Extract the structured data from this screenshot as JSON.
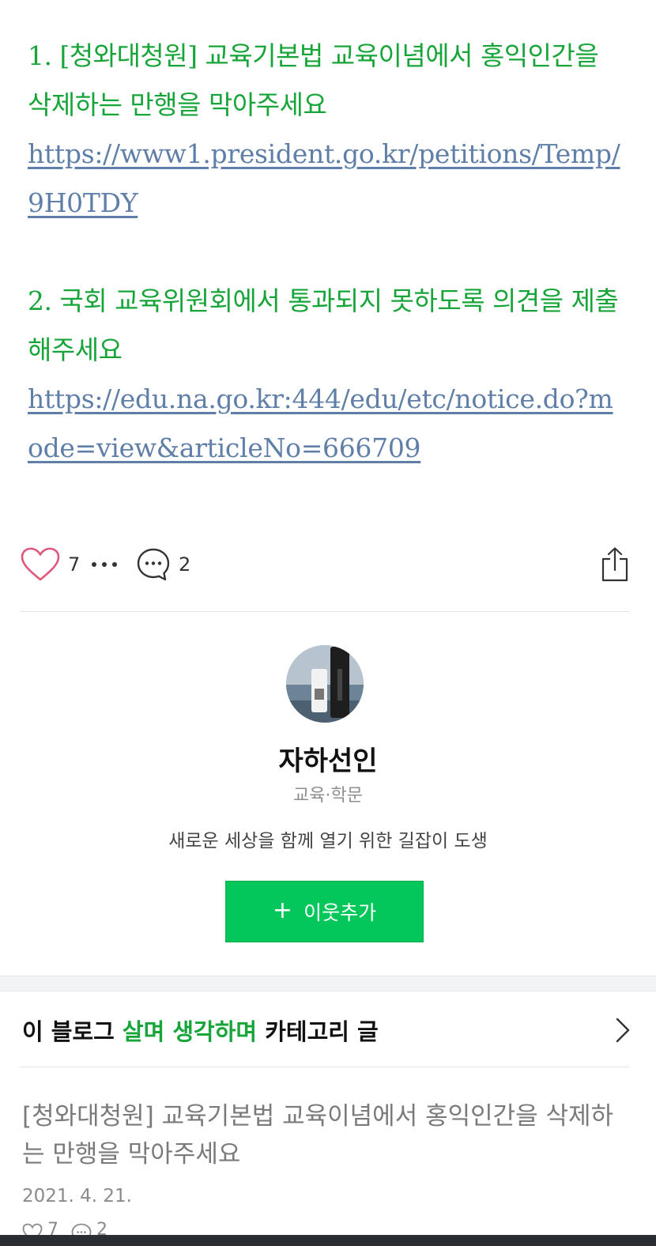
{
  "post": {
    "item1_title": "1. [청와대청원] 교육기본법 교육이념에서 홍익인간을 삭제하는 만행을 막아주세요",
    "item1_link": "https://www1.president.go.kr/petitions/Temp/9H0TDY",
    "item2_title": "2. 국회 교육위원회에서 통과되지 못하도록 의견을 제출해주세요",
    "item2_link": "https://edu.na.go.kr:444/edu/etc/notice.do?mode=view&articleNo=666709"
  },
  "actions": {
    "like_count": "7",
    "comment_count": "2",
    "heart_icon": "heart-icon",
    "more_icon": "more-dots-icon",
    "comment_icon": "comment-bubble-icon",
    "share_icon": "share-icon"
  },
  "profile": {
    "name": "자하선인",
    "category": "교육·학문",
    "description": "새로운 세상을 함께 열기 위한 길잡이 도생",
    "add_neighbor_label": "이웃추가",
    "add_neighbor_plus": "+"
  },
  "category_section": {
    "prefix": "이 블로그 ",
    "category_name": "살며 생각하며",
    "suffix": " 카테고리 글"
  },
  "related": {
    "title": "[청와대청원] 교육기본법 교육이념에서 홍익인간을 삭제하는 만행을 막아주세요",
    "date": "2021. 4. 21.",
    "like_count": "7",
    "comment_count": "2"
  },
  "colors": {
    "accent_green": "#17a53a",
    "button_green": "#03c75a",
    "link_blue": "#5f7fa8",
    "heart_pink": "#e0557a"
  }
}
